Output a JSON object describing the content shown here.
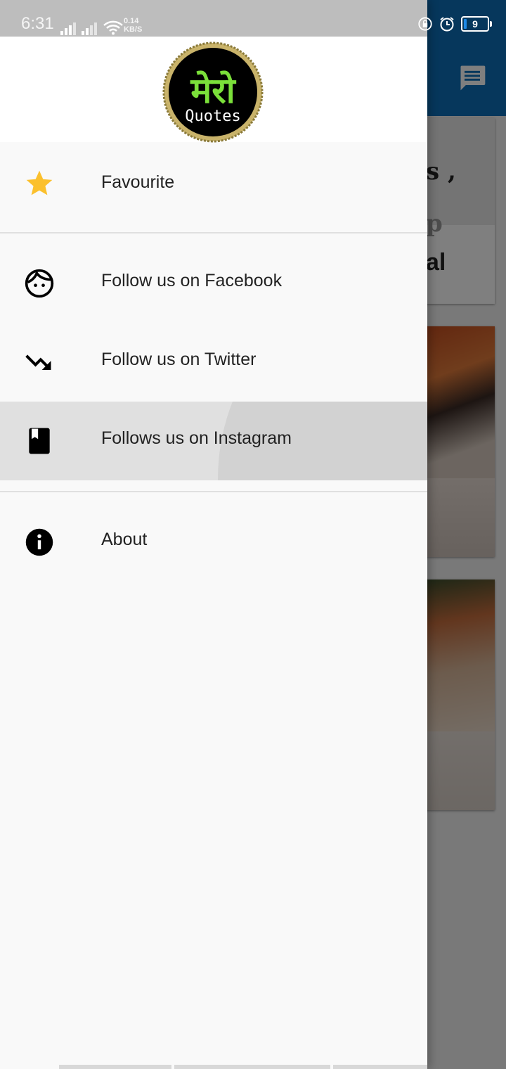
{
  "status_bar": {
    "time": "6:31",
    "net_speed_value": "0.14",
    "net_speed_unit": "KB/S",
    "battery_level": "9"
  },
  "drawer": {
    "logo": {
      "script_text": "मेरो",
      "text": "Quotes"
    },
    "items": [
      {
        "label": "Favourite",
        "icon": "star-icon"
      },
      {
        "label": "Follow us on Facebook",
        "icon": "face-icon"
      },
      {
        "label": "Follow us on Twitter",
        "icon": "trending-down-icon"
      },
      {
        "label": "Follows us on Instagram",
        "icon": "book-icon",
        "selected": true
      },
      {
        "label": "About",
        "icon": "info-icon"
      }
    ]
  },
  "background_app": {
    "card_text": [
      "s ,",
      "p",
      "al"
    ]
  },
  "colors": {
    "app_bar": "#0d6fb8",
    "star": "#fbc02d",
    "logo_green": "#7be03a",
    "selected_bg": "#e0e0e0"
  }
}
